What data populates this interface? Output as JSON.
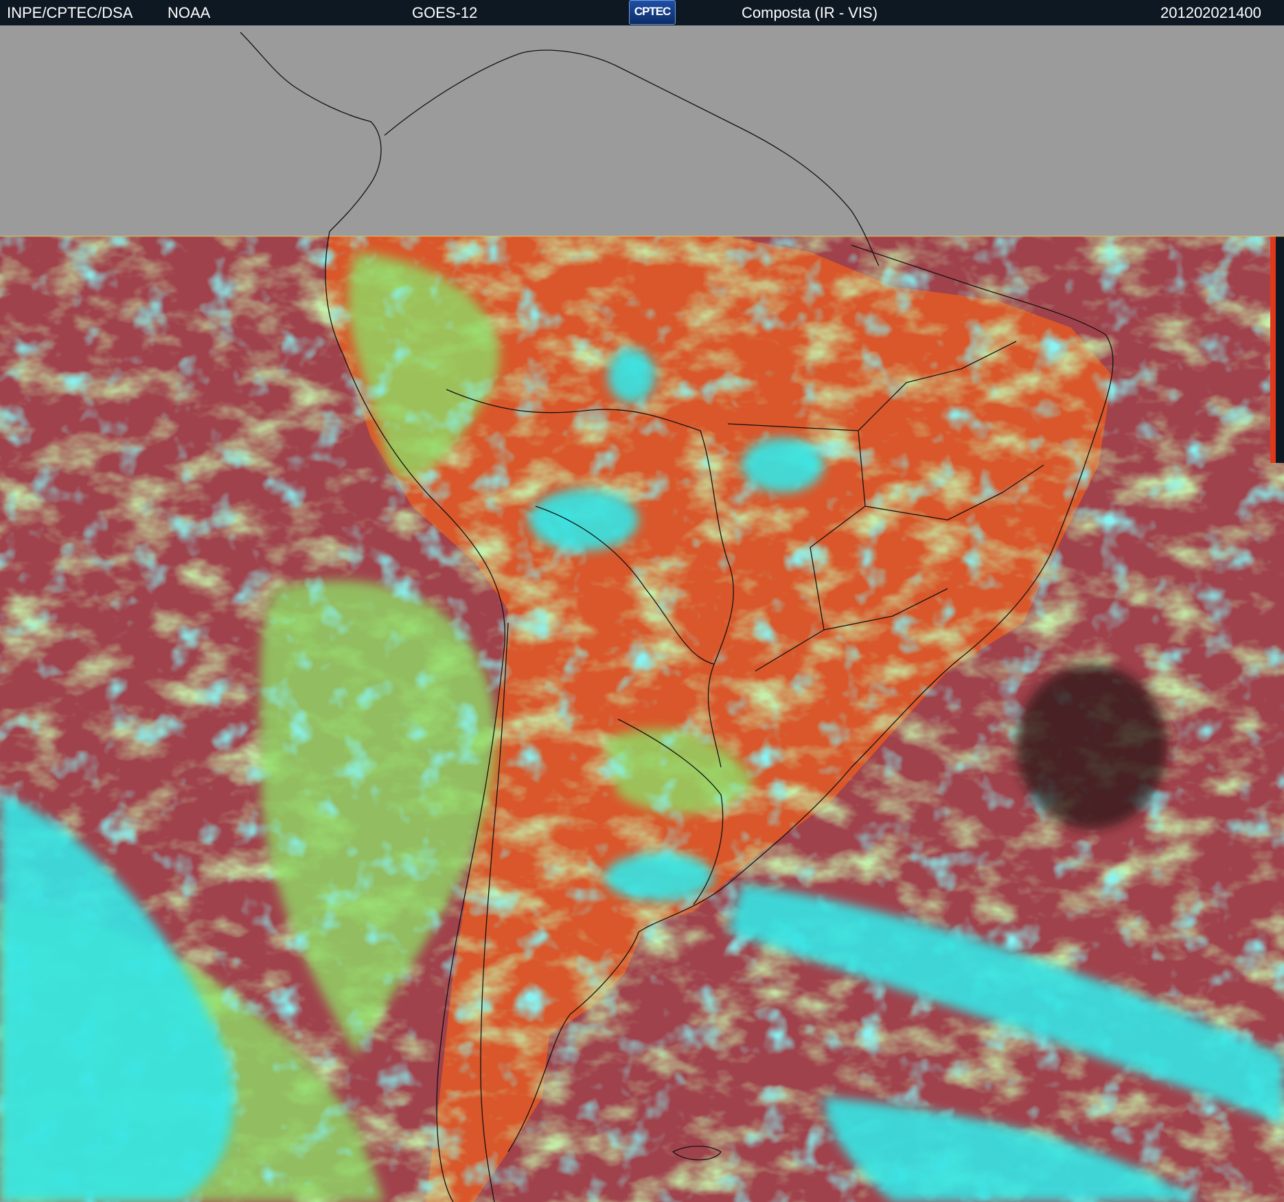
{
  "header": {
    "agency": "INPE/CPTEC/DSA",
    "partner": "NOAA",
    "satellite": "GOES-12",
    "logo_text": "CPTEC",
    "product": "Composta (IR - VIS)",
    "timestamp": "201202021400"
  },
  "colors": {
    "header_bg": "#0e1822",
    "no_data": "#9b9b9b",
    "ocean_clear": "#a0424c",
    "land_clear": "#d9572a",
    "low_cloud": "#8fdc66",
    "high_cloud": "#35e6e6",
    "coastline": "#111111"
  }
}
